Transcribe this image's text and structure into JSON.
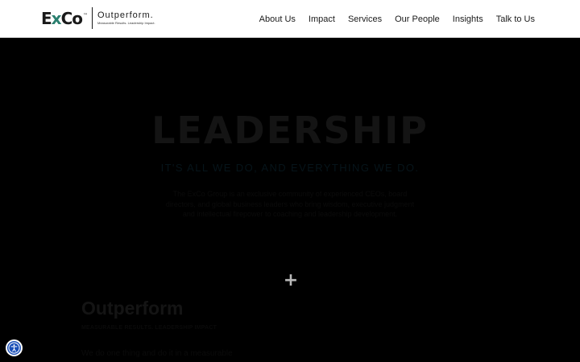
{
  "colors": {
    "accent": "#2a7f6f",
    "header_bg": "#ffffff",
    "hero_bg": "#000000",
    "a11y_button": "#1a4fb8"
  },
  "logo": {
    "mark_left": "E",
    "mark_x": "x",
    "mark_right": "Co",
    "tm": "™",
    "tagline": "Outperform.",
    "tagline_sub": "Measurable Results. Leadership Impact."
  },
  "nav": {
    "items": [
      "About Us",
      "Impact",
      "Services",
      "Our People",
      "Insights",
      "Talk to Us"
    ]
  },
  "hero": {
    "title": "LEADERSHIP",
    "subtitle": "IT'S ALL WE DO, AND EVERYTHING WE DO.",
    "body": "The ExCo Group is an exclusive community of experienced CEOs, board directors, and global business leaders who bring wisdom, executive judgment and intellectual firepower to coaching and leadership development."
  },
  "section": {
    "title": "Outperform",
    "subtitle": "MEASURABLE RESULTS. LEADERSHIP IMPACT",
    "body": "We do one thing and do it in a measurable"
  },
  "icons": {
    "plus": "+",
    "accessibility": "accessibility-icon"
  }
}
